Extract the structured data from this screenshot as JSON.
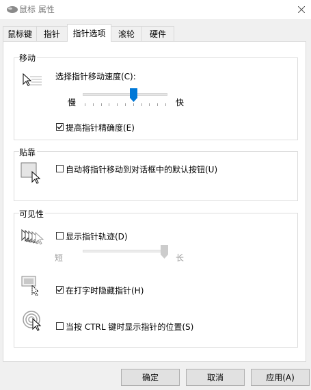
{
  "window": {
    "title": "鼠标 属性"
  },
  "tabs": [
    {
      "label": "鼠标键",
      "active": false
    },
    {
      "label": "指针",
      "active": false
    },
    {
      "label": "指针选项",
      "active": true
    },
    {
      "label": "滚轮",
      "active": false
    },
    {
      "label": "硬件",
      "active": false
    }
  ],
  "motion": {
    "group_label": "移动",
    "speed_label": "选择指针移动速度(C):",
    "slow_label": "慢",
    "fast_label": "快",
    "speed_value_fraction": 0.6,
    "precision_label": "提高指针精确度(E)",
    "precision_checked": true
  },
  "snap": {
    "group_label": "贴靠",
    "snap_label": "自动将指针移动到对话框中的默认按钮(U)",
    "snap_checked": false
  },
  "visibility": {
    "group_label": "可见性",
    "trails_label": "显示指针轨迹(D)",
    "trails_checked": false,
    "short_label": "短",
    "long_label": "长",
    "trails_value_fraction": 1.0,
    "hide_label": "在打字时隐藏指针(H)",
    "hide_checked": true,
    "ctrl_label": "当按 CTRL 键时显示指针的位置(S)",
    "ctrl_checked": false
  },
  "buttons": {
    "ok": "确定",
    "cancel": "取消",
    "apply": "应用(A)"
  },
  "colors": {
    "accent": "#0078d7",
    "disabled": "#9a9a9a"
  }
}
